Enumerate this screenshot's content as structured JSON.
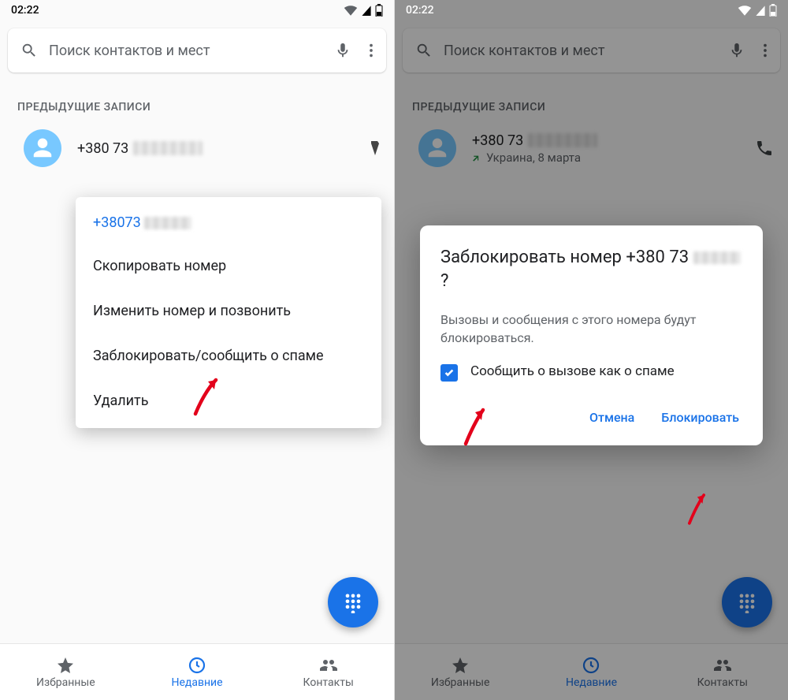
{
  "status": {
    "time": "02:22"
  },
  "search": {
    "placeholder": "Поиск контактов и мест"
  },
  "section_header": "ПРЕДЫДУЩИЕ ЗАПИСИ",
  "call": {
    "number_prefix": "+380 73",
    "sub_country": "Украина, 8 марта"
  },
  "ctx": {
    "number_link": "+38073",
    "copy": "Скопировать номер",
    "edit": "Изменить номер и позвонить",
    "block": "Заблокировать/сообщить о спаме",
    "delete": "Удалить"
  },
  "dialog": {
    "title_pre": "Заблокировать номер +380 73",
    "title_post": "?",
    "body": "Вызовы и сообщения с этого номера будут блокироваться.",
    "spam_label": "Сообщить о вызове как о спаме",
    "cancel": "Отмена",
    "confirm": "Блокировать"
  },
  "tabs": {
    "fav": "Избранные",
    "recent": "Недавние",
    "contacts": "Контакты"
  }
}
